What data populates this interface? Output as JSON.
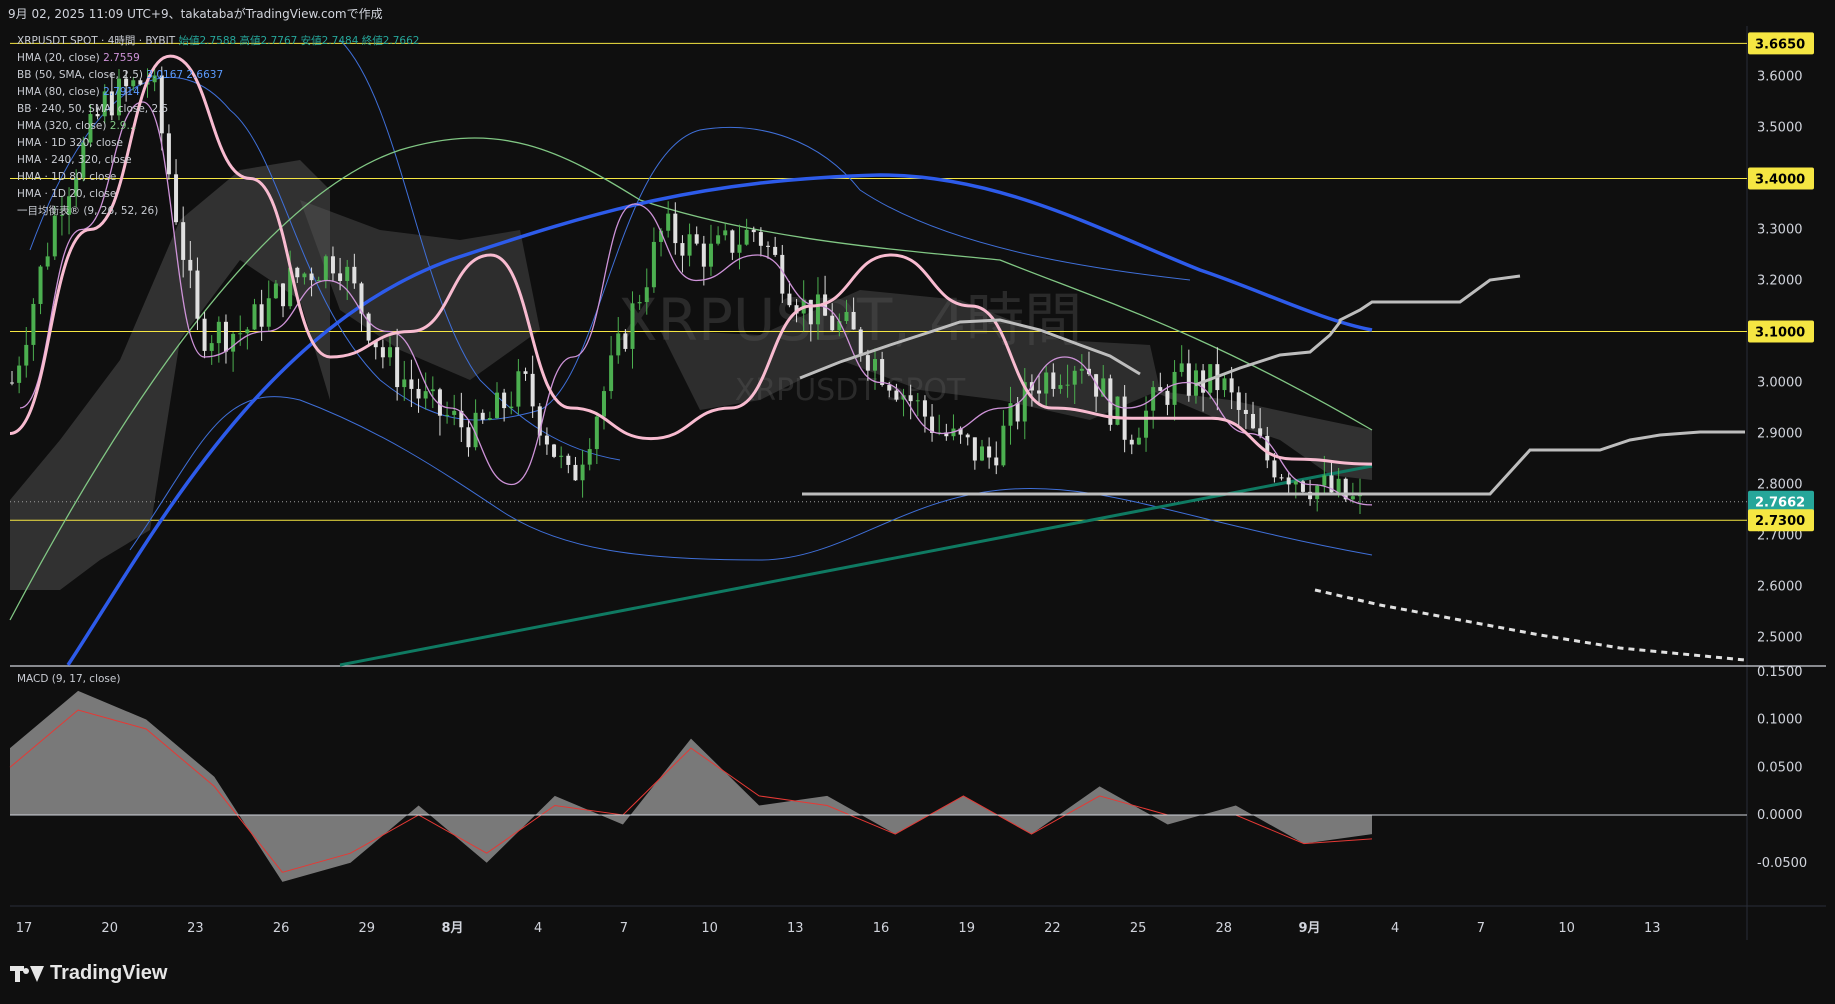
{
  "header": {
    "caption": "9月 02, 2025 11:09 UTC+9、takatabaがTradingView.comで作成"
  },
  "footer": {
    "brand": "TradingView"
  },
  "legend": [
    {
      "label": "XRPUSDT SPOT · 4時間 · BYBIT",
      "values": "始値2.7588 高値2.7767 安値2.7484 終値2.7662",
      "color": "#26a69a"
    },
    {
      "label": "HMA (20, close)",
      "values": "2.7559",
      "color": "#ce93d8"
    },
    {
      "label": "BB (50, SMA, close, 2.5)",
      "values": "3.0167 2.6637",
      "color": "#5b9bff"
    },
    {
      "label": "HMA (80, close)",
      "values": "2.7914",
      "color": "#5b9bff"
    },
    {
      "label": "BB · 240, 50, SMA, close, 2.5",
      "values": "",
      "color": "#c9ccd3"
    },
    {
      "label": "HMA (320, close)",
      "values": "2.9...",
      "color": "#81c784"
    },
    {
      "label": "HMA · 1D 320, close",
      "values": "",
      "color": "#c9ccd3"
    },
    {
      "label": "HMA · 240, 320, close",
      "values": "",
      "color": "#c9ccd3"
    },
    {
      "label": "HMA · 1D 80, close",
      "values": "",
      "color": "#c9ccd3"
    },
    {
      "label": "HMA · 1D 20, close",
      "values": "",
      "color": "#c9ccd3"
    },
    {
      "label": "一目均衡表® (9, 26, 52, 26)",
      "values": "",
      "color": "#c9ccd3"
    }
  ],
  "macd_legend": "MACD (9, 17, close)",
  "watermark": {
    "title": "XRPUSDT, 4時間",
    "subtitle": "XRPUSDT SPOT"
  },
  "price_axis": {
    "ticks": [
      "3.6000",
      "3.5000",
      "3.4000",
      "3.3000",
      "3.2000",
      "3.1000",
      "3.0000",
      "2.9000",
      "2.8000",
      "2.7000",
      "2.6000",
      "2.5000"
    ],
    "tick_values": [
      3.6,
      3.5,
      3.4,
      3.3,
      3.2,
      3.1,
      3.0,
      2.9,
      2.8,
      2.7,
      2.6,
      2.5
    ],
    "highlighted": [
      {
        "label": "3.6650",
        "value": 3.665,
        "bg": "#f5e642",
        "fg": "#000000"
      },
      {
        "label": "3.4000",
        "value": 3.4,
        "bg": "#f5e642",
        "fg": "#000000"
      },
      {
        "label": "3.1000",
        "value": 3.1,
        "bg": "#f5e642",
        "fg": "#000000"
      },
      {
        "label": "2.7662",
        "value": 2.7662,
        "bg": "#26a69a",
        "fg": "#ffffff"
      },
      {
        "label": "2.7300",
        "value": 2.73,
        "bg": "#f5e642",
        "fg": "#000000"
      }
    ]
  },
  "macd_axis": {
    "ticks": [
      "0.1500",
      "0.1000",
      "0.0500",
      "0.0000",
      "-0.0500"
    ],
    "tick_values": [
      0.15,
      0.1,
      0.05,
      0.0,
      -0.05
    ]
  },
  "time_axis": {
    "labels": [
      "17",
      "20",
      "23",
      "26",
      "29",
      "8月",
      "4",
      "7",
      "10",
      "13",
      "16",
      "19",
      "22",
      "25",
      "28",
      "9月",
      "4",
      "7",
      "10",
      "13"
    ],
    "bold": [
      5,
      15
    ]
  },
  "colors": {
    "background": "#0f0f0f",
    "grid": "#1e1e1e",
    "up": "#4caf50",
    "down": "#e0e0e0",
    "hline": "#f5e642",
    "hma20": "#ce93d8",
    "hma80": "#f8bbd0",
    "bb": "#3f6fd8",
    "hma320": "#81c784",
    "hma_blue": "#2d5bea",
    "green_line": "#0f7a62",
    "macd_hist": "#9e9e9e",
    "macd_signal": "#e53935"
  },
  "chart_data": {
    "type": "line",
    "title": "XRPUSDT SPOT · 4時間 · BYBIT",
    "last_close": 2.7662,
    "ohlc_last": {
      "open": 2.7588,
      "high": 2.7767,
      "low": 2.7484,
      "close": 2.7662
    },
    "horizontal_levels": [
      3.665,
      3.4,
      3.1,
      2.73
    ],
    "x_labels": [
      "17",
      "20",
      "23",
      "26",
      "29",
      "8月",
      "4",
      "7",
      "10",
      "13",
      "16",
      "19",
      "22",
      "25",
      "28",
      "9月"
    ],
    "price_path_approx": [
      3.0,
      3.35,
      3.55,
      3.6,
      3.1,
      3.1,
      3.2,
      3.25,
      3.05,
      2.95,
      2.9,
      3.0,
      2.8,
      3.05,
      3.3,
      3.25,
      3.3,
      3.15,
      3.1,
      3.0,
      2.9,
      2.85,
      3.0,
      3.05,
      2.9,
      3.0,
      3.0,
      2.85,
      2.8,
      2.76
    ],
    "hma20_path_approx": [
      2.95,
      3.3,
      3.55,
      3.05,
      3.1,
      3.2,
      3.1,
      2.95,
      2.8,
      3.05,
      3.35,
      3.2,
      3.25,
      3.15,
      3.0,
      2.9,
      2.95,
      3.05,
      2.95,
      3.0,
      2.9,
      2.8,
      2.76
    ],
    "hma80_path_approx": [
      2.9,
      3.3,
      3.64,
      3.4,
      3.05,
      3.1,
      3.25,
      2.95,
      2.89,
      2.95,
      3.15,
      3.25,
      3.15,
      2.95,
      2.93,
      2.93,
      2.85,
      2.84
    ],
    "hma_blue_path_approx": [
      2.45,
      2.95,
      3.1,
      3.2,
      3.28,
      3.33,
      3.39,
      3.41,
      3.35,
      3.25,
      3.1
    ],
    "macd_hist_approx": [
      0.07,
      0.13,
      0.1,
      0.04,
      -0.07,
      -0.05,
      0.01,
      -0.05,
      0.02,
      -0.01,
      0.08,
      0.01,
      0.02,
      -0.02,
      0.02,
      -0.02,
      0.03,
      -0.01,
      0.01,
      -0.03,
      -0.02
    ],
    "macd_signal_approx": [
      0.05,
      0.11,
      0.09,
      0.03,
      -0.06,
      -0.04,
      0.0,
      -0.04,
      0.01,
      0.0,
      0.07,
      0.02,
      0.01,
      -0.02,
      0.02,
      -0.02,
      0.02,
      0.0,
      0.0,
      -0.03,
      -0.025
    ]
  }
}
